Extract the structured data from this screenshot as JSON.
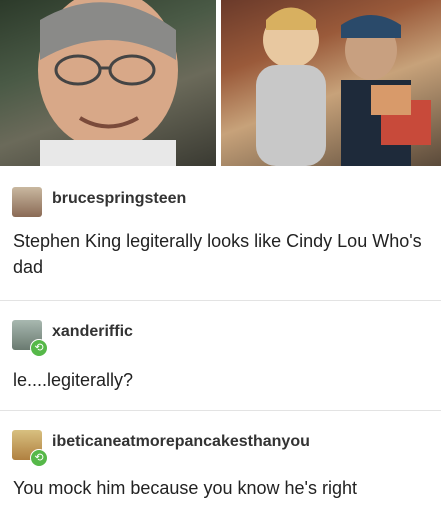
{
  "images": {
    "left_photo": "stephen-king-photo",
    "right_photo": "cindy-lou-who-dad-photo"
  },
  "posts": [
    {
      "username": "brucespringsteen",
      "avatar": "avatar-image",
      "reblog": false,
      "text": "Stephen King legiterally looks like Cindy Lou Who's dad"
    },
    {
      "username": "xanderiffic",
      "avatar": "avatar-image",
      "reblog": true,
      "text": "le....legiterally?"
    },
    {
      "username": "ibeticaneatmorepancakesthanyou",
      "avatar": "avatar-image",
      "reblog": true,
      "text": "You mock him because you know he's right"
    }
  ],
  "colors": {
    "reblog_green": "#56b849",
    "divider": "#e3e3e3"
  }
}
